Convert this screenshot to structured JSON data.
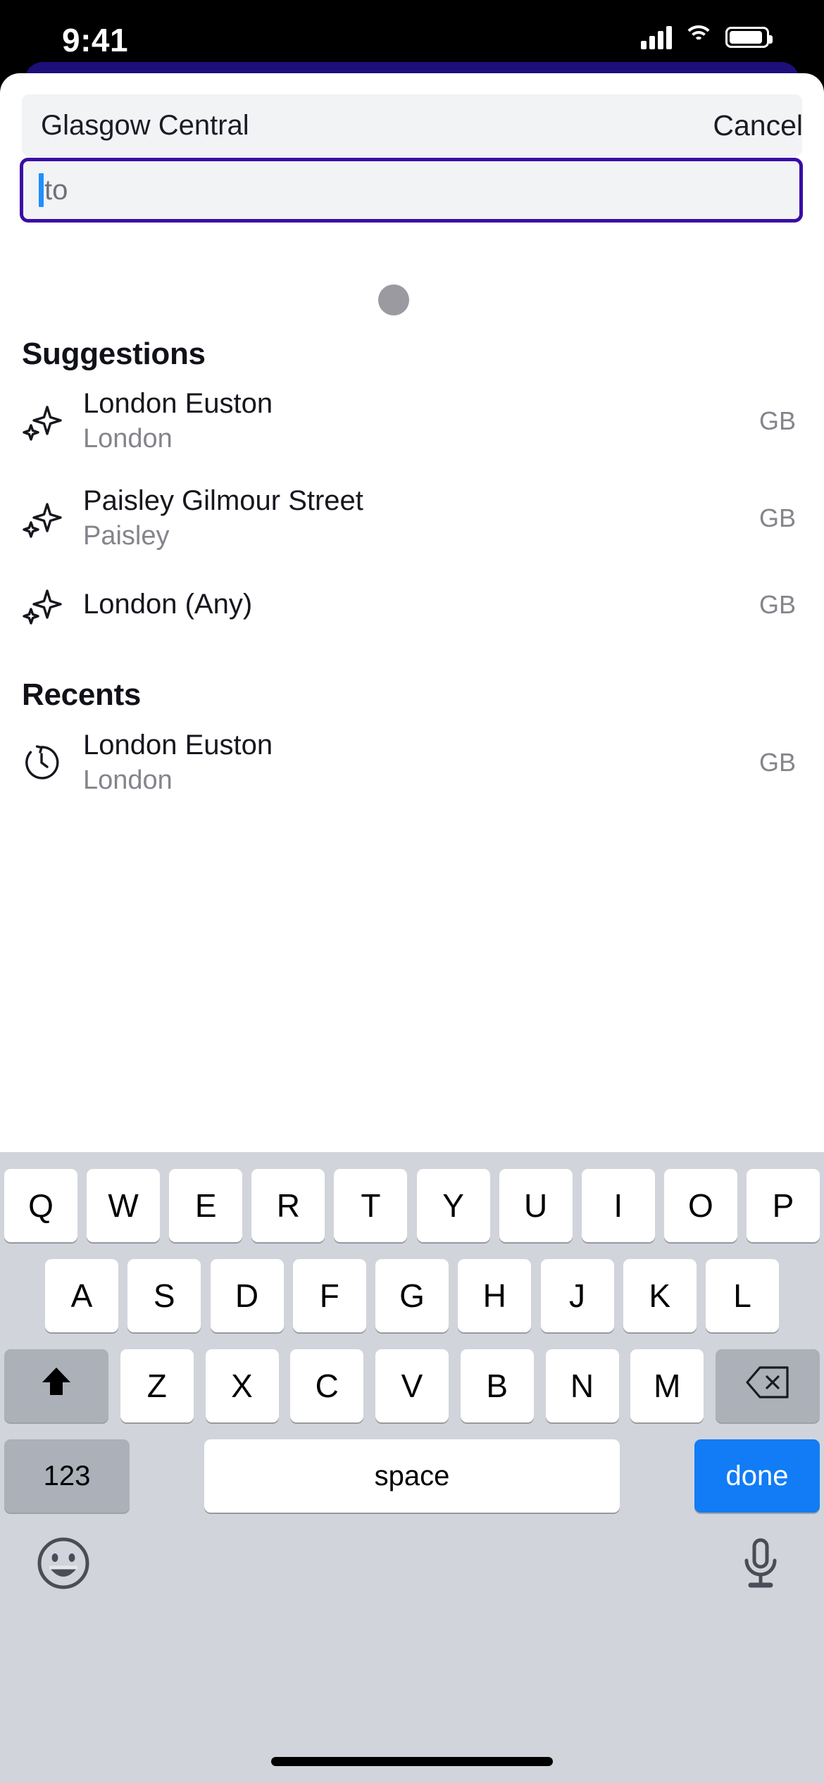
{
  "status_bar": {
    "time": "9:41",
    "icons": [
      "cellular-signal-icon",
      "wifi-icon",
      "battery-icon"
    ]
  },
  "search": {
    "from_value": "Glasgow Central",
    "to_value": "",
    "to_placeholder": "to",
    "cancel_label": "Cancel"
  },
  "sections": {
    "suggestions_title": "Suggestions",
    "recents_title": "Recents"
  },
  "suggestions": [
    {
      "icon": "sparkle-icon",
      "name": "London Euston",
      "subtitle": "London",
      "country": "GB"
    },
    {
      "icon": "sparkle-icon",
      "name": "Paisley Gilmour Street",
      "subtitle": "Paisley",
      "country": "GB"
    },
    {
      "icon": "sparkle-icon",
      "name": "London (Any)",
      "subtitle": "",
      "country": "GB"
    }
  ],
  "recents": [
    {
      "icon": "history-clock-icon",
      "name": "London Euston",
      "subtitle": "London",
      "country": "GB"
    }
  ],
  "keyboard": {
    "row1": [
      "Q",
      "W",
      "E",
      "R",
      "T",
      "Y",
      "U",
      "I",
      "O",
      "P"
    ],
    "row2": [
      "A",
      "S",
      "D",
      "F",
      "G",
      "H",
      "J",
      "K",
      "L"
    ],
    "row3_letters": [
      "Z",
      "X",
      "C",
      "V",
      "B",
      "N",
      "M"
    ],
    "shift_icon": "shift-arrow-icon",
    "backspace_icon": "backspace-icon",
    "numbers_label": "123",
    "space_label": "space",
    "done_label": "done",
    "emoji_icon": "emoji-smiley-icon",
    "mic_icon": "microphone-icon"
  },
  "colors": {
    "accent_purple": "#3a0ca3",
    "card_purple": "#1d0f7a",
    "caret_blue": "#1f8fff",
    "done_blue": "#117cf5",
    "keyboard_bg": "#d1d4da",
    "field_bg": "#f2f3f5",
    "muted_text": "#84848c"
  }
}
